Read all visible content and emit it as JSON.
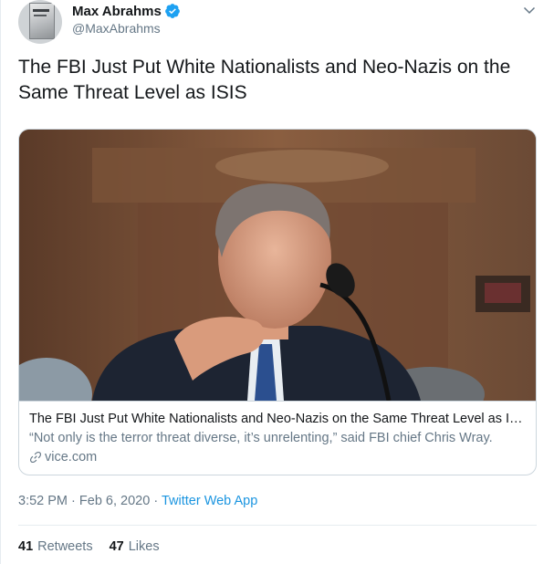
{
  "author": {
    "display_name": "Max Abrahms",
    "handle": "@MaxAbrahms",
    "avatar_icon": "book-cover-avatar",
    "verified": true
  },
  "tweet": {
    "text": "The FBI Just Put White Nationalists and Neo-Nazis on the Same Threat Level as ISIS"
  },
  "card": {
    "title": "The FBI Just Put White Nationalists and Neo-Nazis on the Same Threat Level as ISIS",
    "description": "“Not only is the terror threat diverse, it’s unrelenting,” said FBI chief Chris Wray.",
    "domain": "vice.com"
  },
  "meta": {
    "time": "3:52 PM",
    "separator": "·",
    "date": "Feb 6, 2020",
    "separator2": "·",
    "source": "Twitter Web App"
  },
  "stats": {
    "retweets_count": "41",
    "retweets_label": "Retweets",
    "likes_count": "47",
    "likes_label": "Likes"
  },
  "colors": {
    "link": "#1b95e0",
    "secondary_text": "#657786",
    "verified": "#1da1f2"
  }
}
